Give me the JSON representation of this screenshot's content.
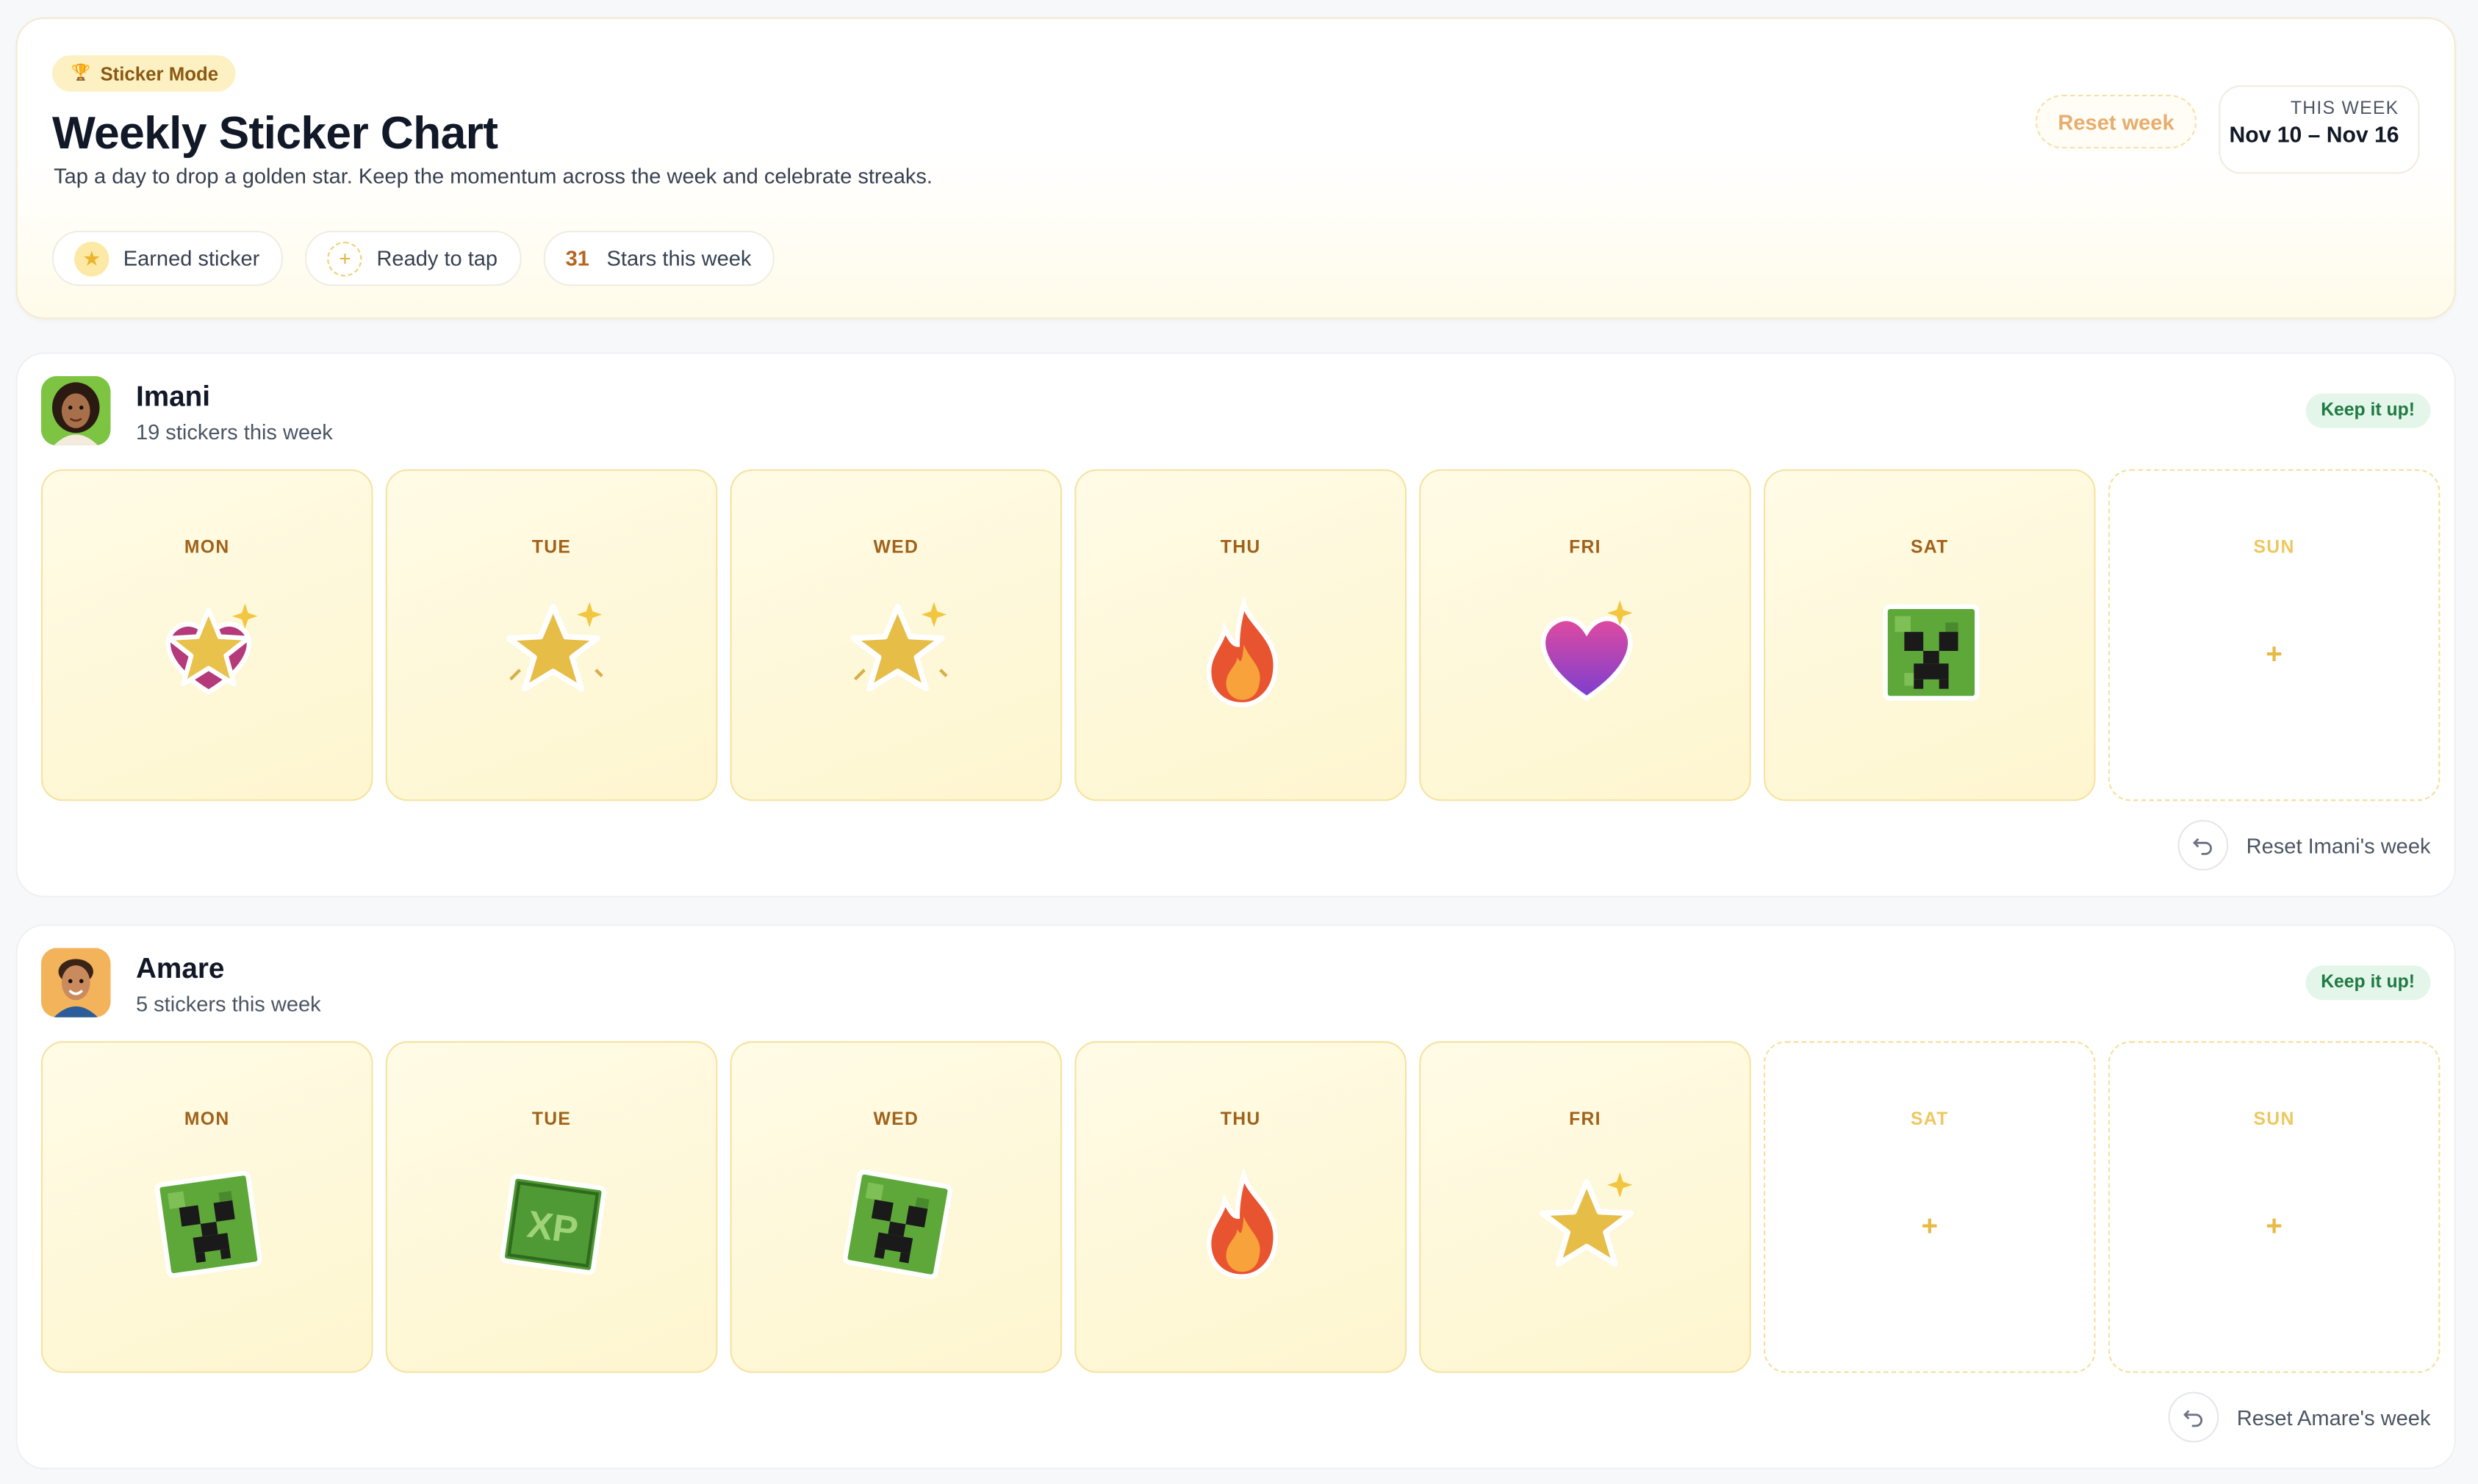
{
  "header": {
    "badge": "Sticker Mode",
    "badge_icon": "trophy-icon",
    "title": "Weekly Sticker Chart",
    "subtitle": "Tap a day to drop a golden star. Keep the momentum across the week and celebrate streaks.",
    "legend": {
      "earned": "Earned sticker",
      "ready": "Ready to tap",
      "stars_count": "31",
      "stars_label": "Stars this week"
    },
    "reset_label": "Reset week",
    "week_label": "THIS WEEK",
    "week_range": "Nov 10 – Nov 16"
  },
  "kids": [
    {
      "name": "Imani",
      "count": "19 stickers this week",
      "status": "Keep it up!",
      "reset_label": "Reset Imani's week",
      "days": [
        {
          "label": "MON",
          "sticker": "star-heart",
          "filled": true
        },
        {
          "label": "TUE",
          "sticker": "star-shine",
          "filled": true
        },
        {
          "label": "WED",
          "sticker": "star-shine",
          "filled": true
        },
        {
          "label": "THU",
          "sticker": "fire",
          "filled": true
        },
        {
          "label": "FRI",
          "sticker": "heart",
          "filled": true
        },
        {
          "label": "SAT",
          "sticker": "creeper",
          "filled": true
        },
        {
          "label": "SUN",
          "sticker": "",
          "filled": false
        }
      ]
    },
    {
      "name": "Amare",
      "count": "5 stickers this week",
      "status": "Keep it up!",
      "reset_label": "Reset Amare's week",
      "days": [
        {
          "label": "MON",
          "sticker": "creeper",
          "filled": true
        },
        {
          "label": "TUE",
          "sticker": "xp-block",
          "filled": true
        },
        {
          "label": "WED",
          "sticker": "creeper",
          "filled": true
        },
        {
          "label": "THU",
          "sticker": "fire",
          "filled": true
        },
        {
          "label": "FRI",
          "sticker": "star",
          "filled": true
        },
        {
          "label": "SAT",
          "sticker": "",
          "filled": false
        },
        {
          "label": "SUN",
          "sticker": "",
          "filled": false
        }
      ]
    }
  ],
  "colors": {
    "accent": "#f5c542",
    "status_green": "#1f7a43",
    "day_label": "#a0621a"
  }
}
